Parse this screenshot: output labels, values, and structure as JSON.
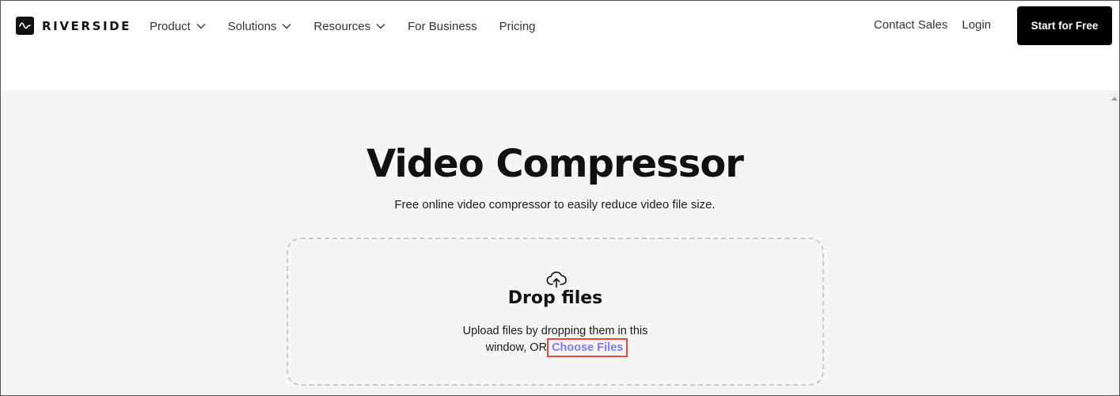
{
  "brand": {
    "name": "RIVERSIDE",
    "logo_icon": "wave-icon"
  },
  "nav": {
    "items": [
      {
        "label": "Product",
        "has_dropdown": true
      },
      {
        "label": "Solutions",
        "has_dropdown": true
      },
      {
        "label": "Resources",
        "has_dropdown": true
      },
      {
        "label": "For Business",
        "has_dropdown": false
      },
      {
        "label": "Pricing",
        "has_dropdown": false
      }
    ],
    "contact_sales": "Contact Sales",
    "login": "Login",
    "cta": "Start for Free"
  },
  "hero": {
    "title": "Video Compressor",
    "subtitle": "Free online video compressor to easily reduce video file size."
  },
  "dropzone": {
    "icon": "cloud-upload-icon",
    "title": "Drop files",
    "description_line1": "Upload files by dropping them in this",
    "description_line2_prefix": "window, OR",
    "choose_files": "Choose Files"
  },
  "colors": {
    "accent_link": "#7b7bf0",
    "highlight_box": "#e04b3f",
    "cta_bg": "#000000",
    "hero_bg": "#f5f5f5"
  }
}
